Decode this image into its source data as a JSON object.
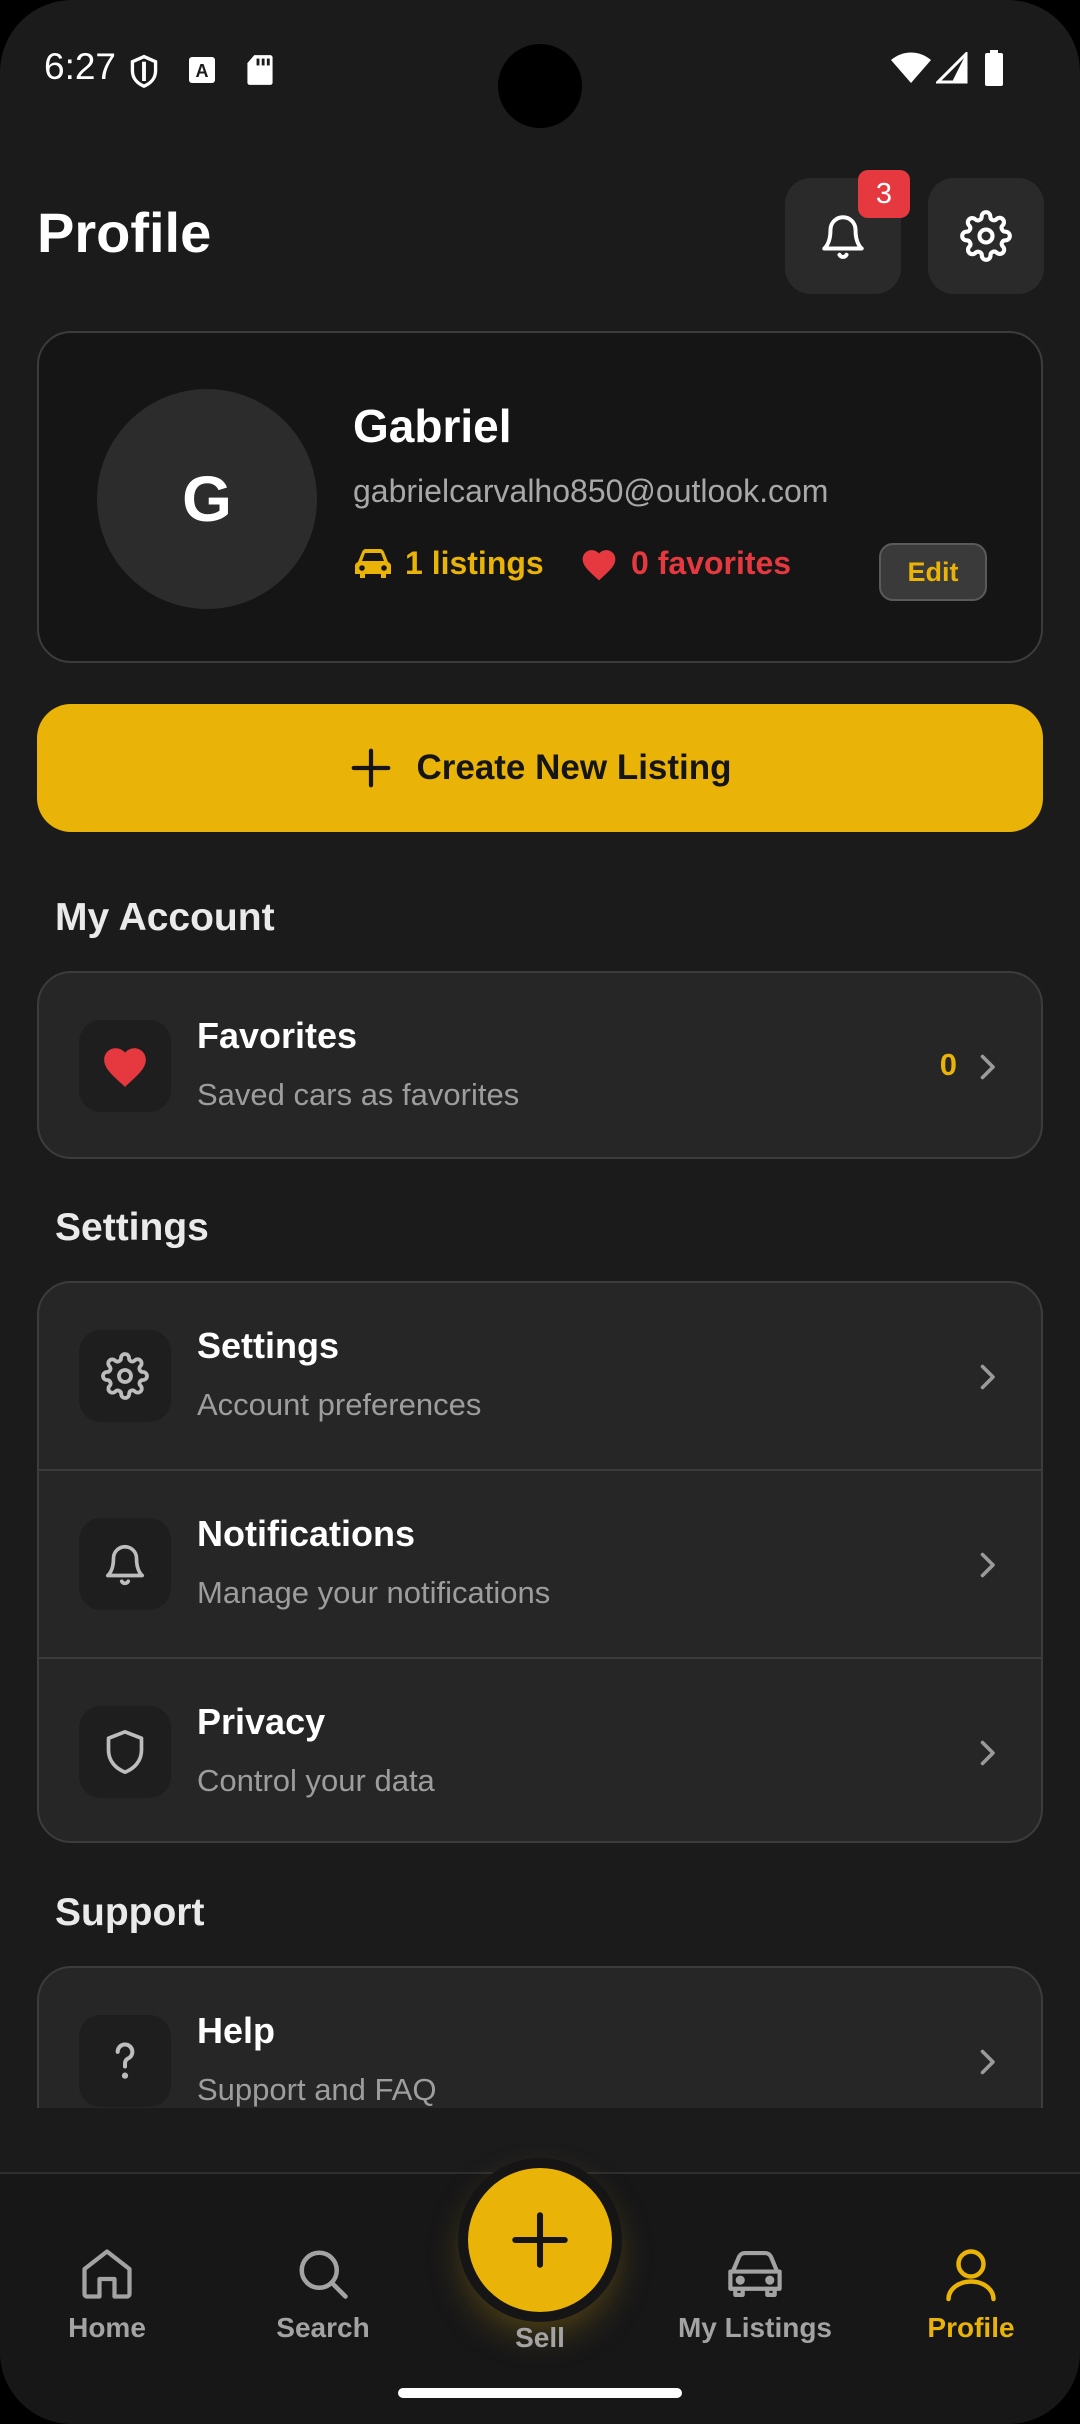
{
  "status_bar": {
    "time": "6:27"
  },
  "header": {
    "title": "Profile",
    "notification_count": "3"
  },
  "profile": {
    "initial": "G",
    "name": "Gabriel",
    "email": "gabrielcarvalho850@outlook.com",
    "listings": "1 listings",
    "favorites": "0 favorites",
    "edit_label": "Edit"
  },
  "create_listing_label": "Create New Listing",
  "sections": {
    "my_account": {
      "title": "My Account",
      "items": [
        {
          "title": "Favorites",
          "subtitle": "Saved cars as favorites",
          "count": "0"
        }
      ]
    },
    "settings": {
      "title": "Settings",
      "items": [
        {
          "title": "Settings",
          "subtitle": "Account preferences"
        },
        {
          "title": "Notifications",
          "subtitle": "Manage your notifications"
        },
        {
          "title": "Privacy",
          "subtitle": "Control your data"
        }
      ]
    },
    "support": {
      "title": "Support",
      "items": [
        {
          "title": "Help",
          "subtitle": "Support and FAQ"
        }
      ]
    }
  },
  "tabs": [
    {
      "label": "Home",
      "icon": "home-icon"
    },
    {
      "label": "Search",
      "icon": "search-icon"
    },
    {
      "label": "Sell",
      "icon": "plus-icon"
    },
    {
      "label": "My Listings",
      "icon": "car-icon"
    },
    {
      "label": "Profile",
      "icon": "user-icon",
      "active": true
    }
  ],
  "colors": {
    "accent": "#e9b308",
    "danger": "#e5393f",
    "background": "#1b1b1c",
    "card": "#262627"
  }
}
